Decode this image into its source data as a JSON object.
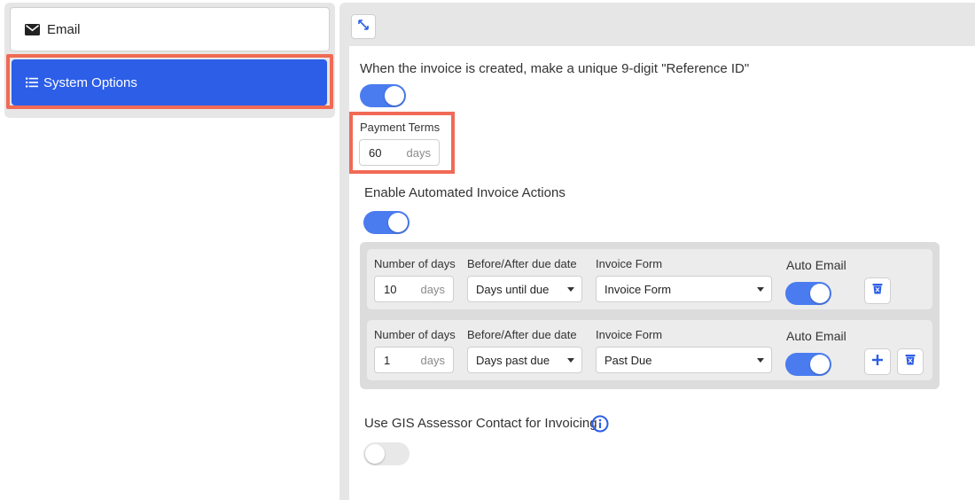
{
  "sidebar": {
    "items": [
      {
        "label": "Email",
        "icon": "envelope-icon"
      },
      {
        "label": "System Options",
        "icon": "list-icon",
        "active": true
      }
    ]
  },
  "main": {
    "reference_id": {
      "label": "When the invoice is created, make a unique 9-digit \"Reference ID\"",
      "enabled": true
    },
    "payment_terms": {
      "label": "Payment Terms",
      "value": "60",
      "unit": "days"
    },
    "automated_actions": {
      "label": "Enable Automated Invoice Actions",
      "enabled": true,
      "columns": {
        "days": "Number of days",
        "timing": "Before/After due date",
        "form": "Invoice Form",
        "auto_email": "Auto Email"
      },
      "rows": [
        {
          "days": "10",
          "unit": "days",
          "timing": "Days until due",
          "form": "Invoice Form",
          "auto_email": true
        },
        {
          "days": "1",
          "unit": "days",
          "timing": "Days past due",
          "form": "Past Due",
          "auto_email": true
        }
      ]
    },
    "gis_contact": {
      "label": "Use GIS Assessor Contact for Invoicing",
      "enabled": false
    }
  },
  "colors": {
    "accent": "#2c5ee8",
    "toggle_on": "#4a7cf0",
    "highlight": "#f06a55"
  }
}
